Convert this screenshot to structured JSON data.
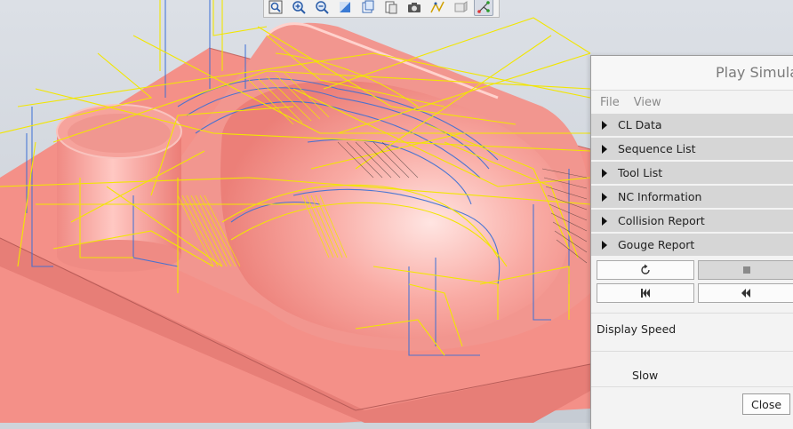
{
  "toolbar": {
    "icons": [
      "zoom-fit-icon",
      "zoom-in-icon",
      "zoom-out-icon",
      "view-shade-icon",
      "saved-views-icon",
      "display-style-icon",
      "screenshot-icon",
      "toolpath-display-icon",
      "hide-icon",
      "path-display-icon"
    ]
  },
  "panel": {
    "title": "Play Simulat",
    "menu": {
      "file": "File",
      "view": "View"
    },
    "sections": [
      "CL Data",
      "Sequence List",
      "Tool List",
      "NC Information",
      "Collision Report",
      "Gouge Report"
    ],
    "display_speed_label": "Display Speed",
    "slow_label": "Slow",
    "close_label": "Close"
  },
  "colors": {
    "part": "#f5918a",
    "part_dark": "#e87c75",
    "toolpath_yellow": "#f2e600",
    "toolpath_blue": "#3a6fd6",
    "background": "#cfd4da"
  }
}
